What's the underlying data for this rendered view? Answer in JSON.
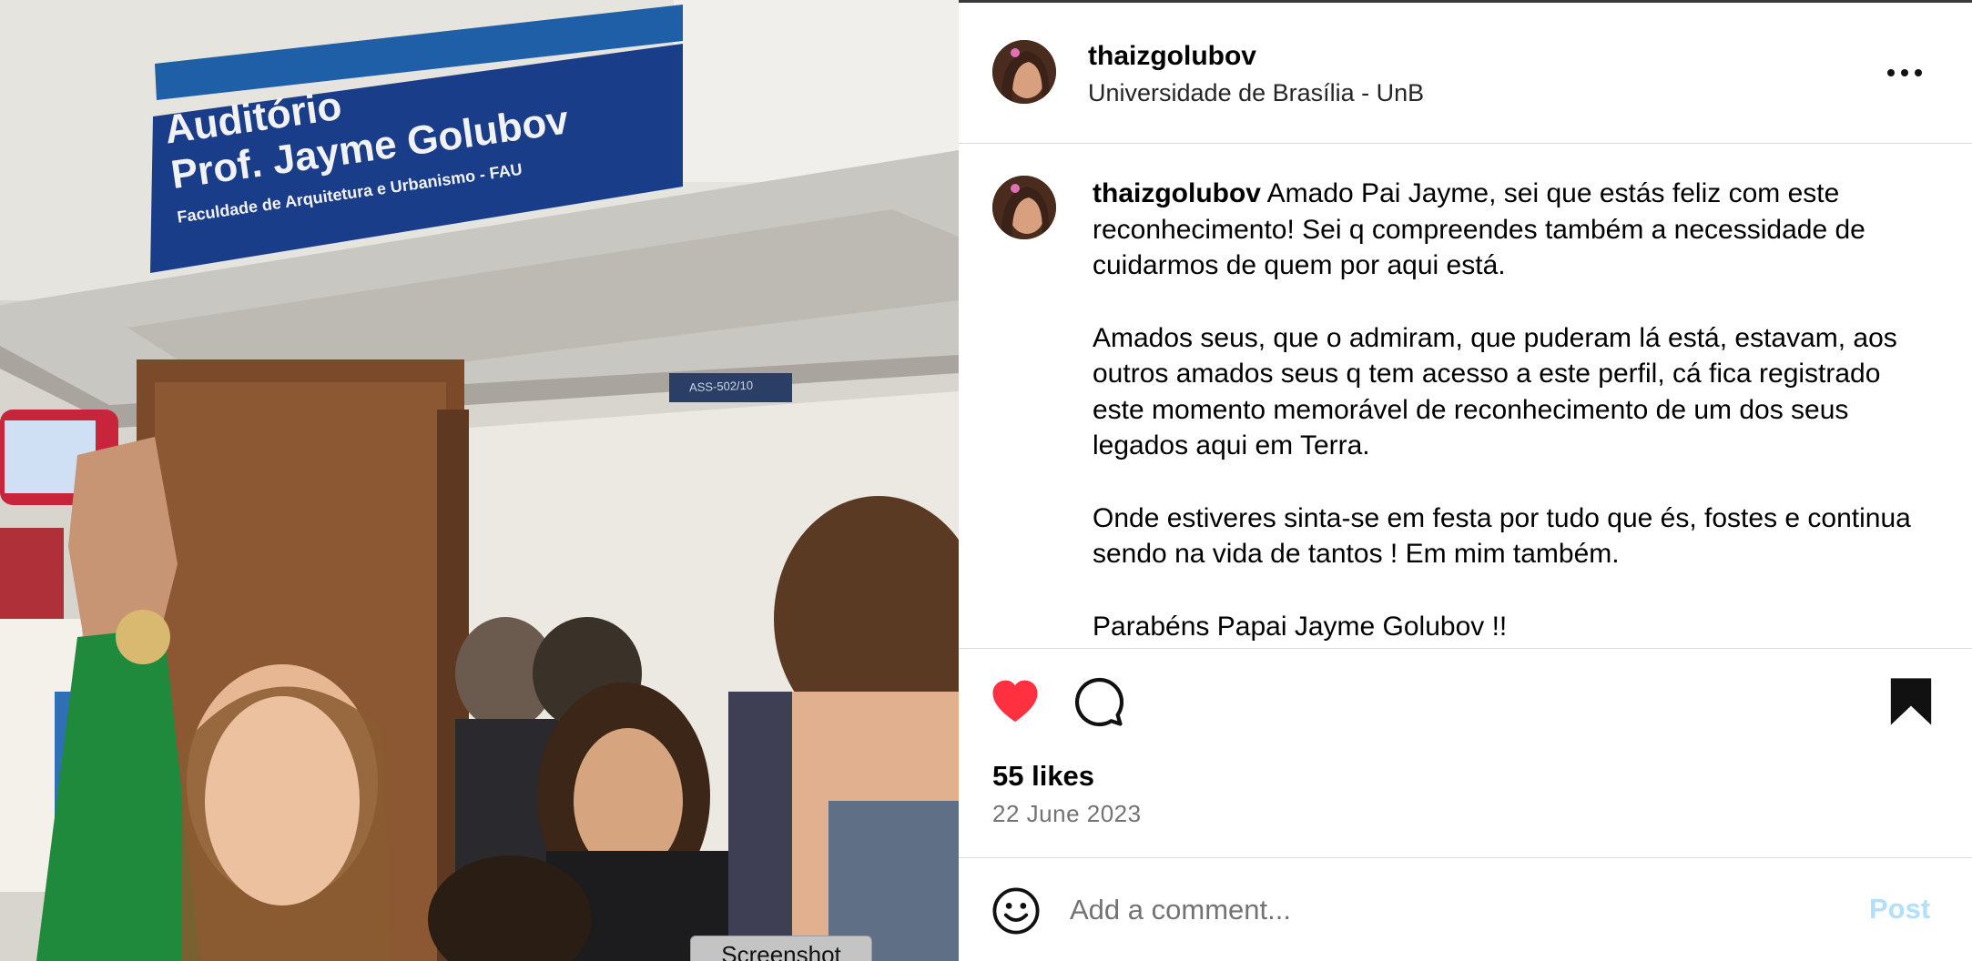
{
  "photo": {
    "sign_line1": "Auditório",
    "sign_line2": "Prof. Jayme Golubov",
    "sign_line3": "Faculdade de Arquitetura e Urbanismo - FAU",
    "door_plate": "ASS-502/10"
  },
  "screenshot_tab": "Screenshot",
  "post": {
    "header": {
      "username": "thaizgolubov",
      "location": "Universidade de Brasília - UnB",
      "more_icon": "more-horizontal-icon"
    },
    "caption": {
      "username": "thaizgolubov",
      "paragraph1": " Amado Pai Jayme, sei que estás feliz com este reconhecimento! Sei q compreendes também a necessidade de cuidarmos de quem por aqui está.",
      "paragraph2": "Amados seus, que o admiram, que puderam lá está, estavam, aos outros amados seus q tem acesso a este perfil, cá fica registrado este momento memorável de reconhecimento de um dos seus legados aqui em Terra.",
      "paragraph3": "Onde estiveres sinta-se em festa por tudo que és, fostes e continua sendo na vida de tantos ! Em mim também.",
      "paragraph4": "Parabéns Papai Jayme Golubov !!"
    },
    "actions": {
      "liked": true,
      "like_color": "#ff3040",
      "likes_text": "55 likes",
      "date_text": "22 June 2023"
    },
    "comment": {
      "placeholder": "Add a comment...",
      "post_label": "Post",
      "post_color": "#b2dffc"
    }
  }
}
